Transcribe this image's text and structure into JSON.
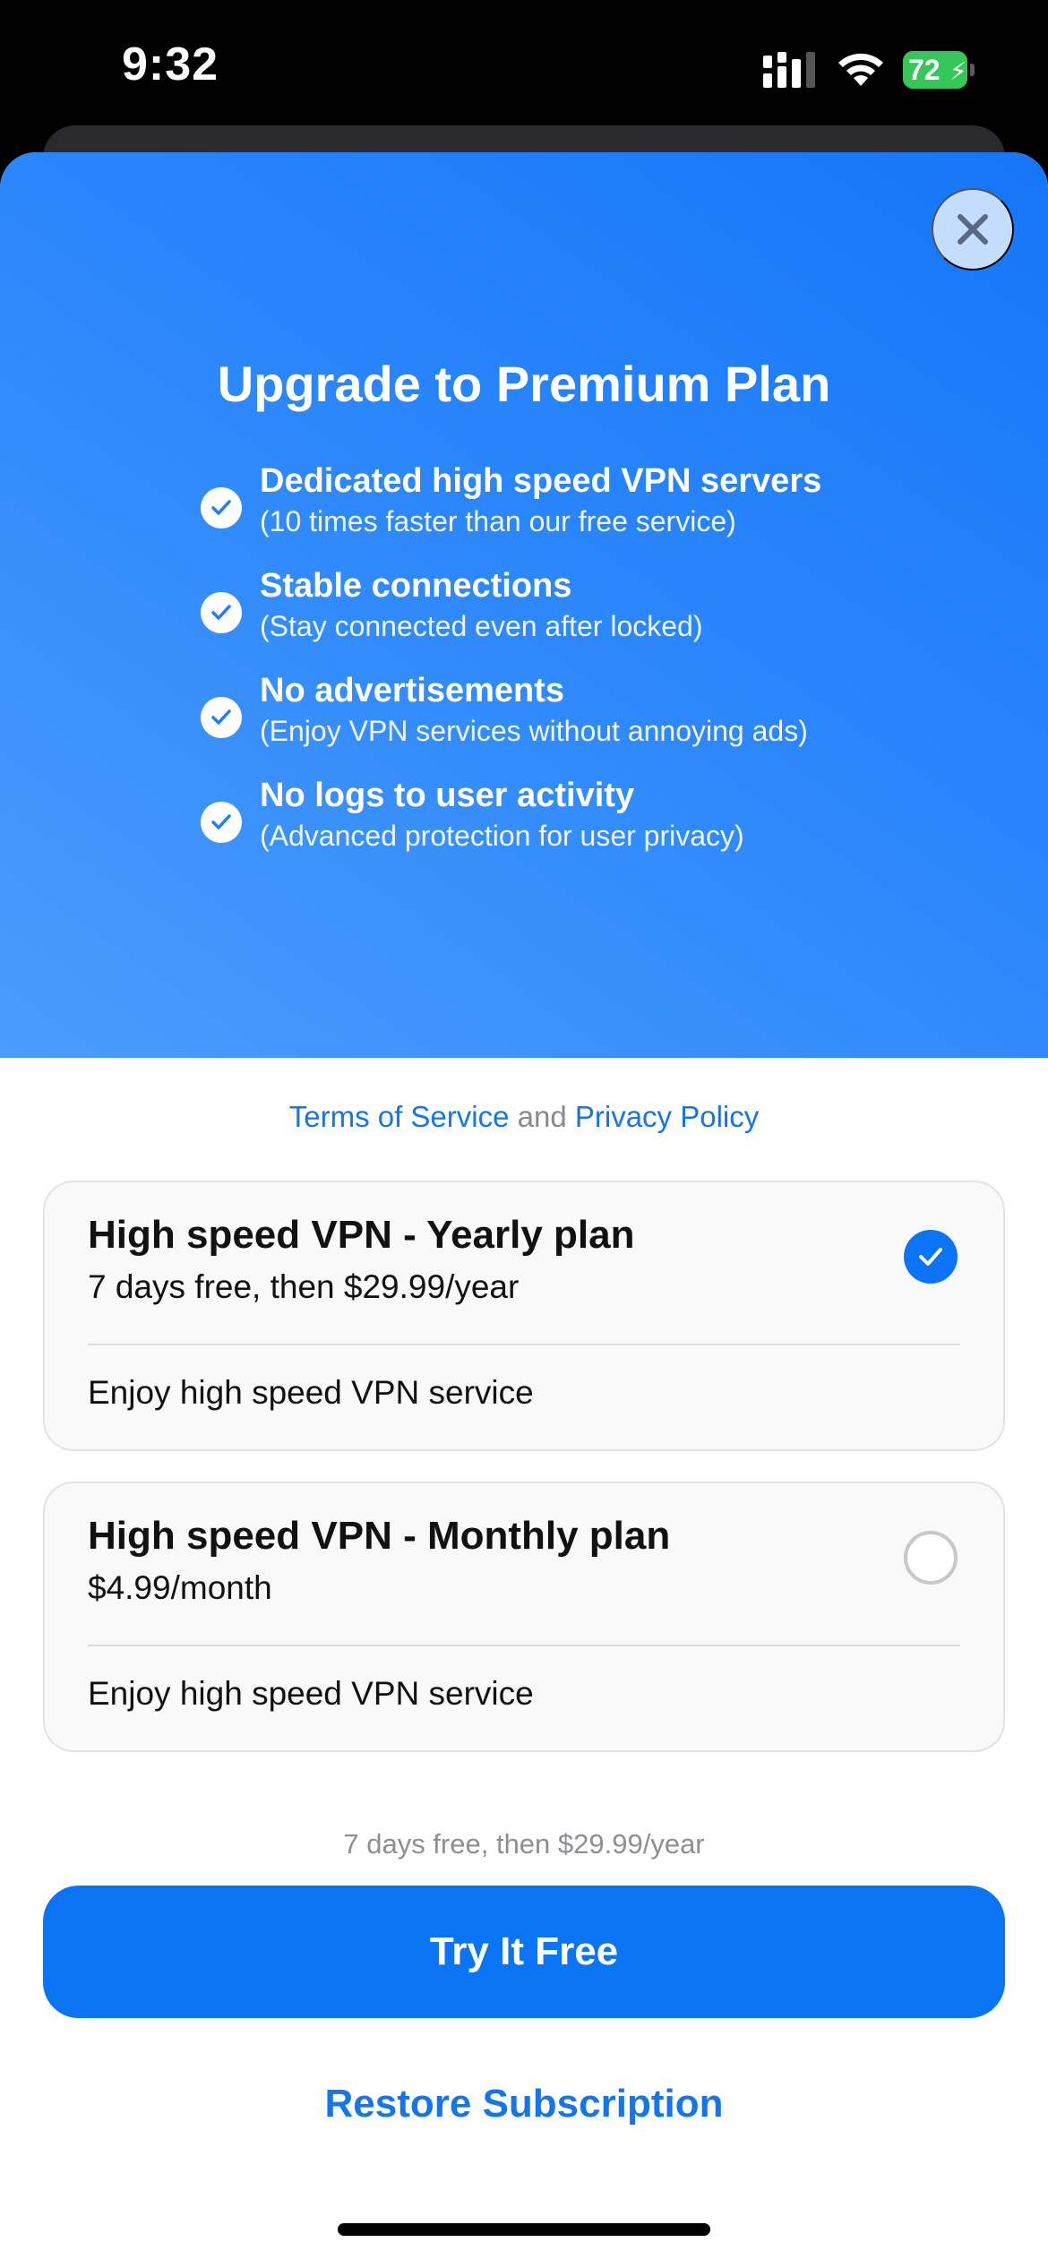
{
  "status_bar": {
    "time": "9:32",
    "battery": "72"
  },
  "hero": {
    "title": "Upgrade to Premium Plan",
    "features": [
      {
        "title": "Dedicated high speed VPN servers",
        "subtitle": "(10 times faster than our free service)"
      },
      {
        "title": "Stable connections",
        "subtitle": "(Stay connected even after locked)"
      },
      {
        "title": "No advertisements",
        "subtitle": "(Enjoy VPN services without annoying ads)"
      },
      {
        "title": "No logs to user activity",
        "subtitle": "(Advanced protection for user privacy)"
      }
    ]
  },
  "links": {
    "terms": "Terms of Service",
    "and": "and",
    "privacy": "Privacy Policy"
  },
  "plans": [
    {
      "name": "High speed VPN - Yearly plan",
      "price": "7 days free, then $29.99/year",
      "description": "Enjoy high speed VPN service",
      "selected": true
    },
    {
      "name": "High speed VPN - Monthly plan",
      "price": "$4.99/month",
      "description": "Enjoy high speed VPN service",
      "selected": false
    }
  ],
  "summary": "7 days free, then $29.99/year",
  "cta_label": "Try It Free",
  "restore_label": "Restore Subscription",
  "colors": {
    "accent": "#0a74f5",
    "hero_gradient_start": "#1476f8",
    "hero_gradient_end": "#4a9cfd",
    "battery": "#35c759"
  },
  "icons": {
    "close": "close-icon",
    "feature_check": "check-circle-icon",
    "radio_selected": "checkmark-circle-filled-icon",
    "radio_unselected": "empty-circle-icon"
  }
}
